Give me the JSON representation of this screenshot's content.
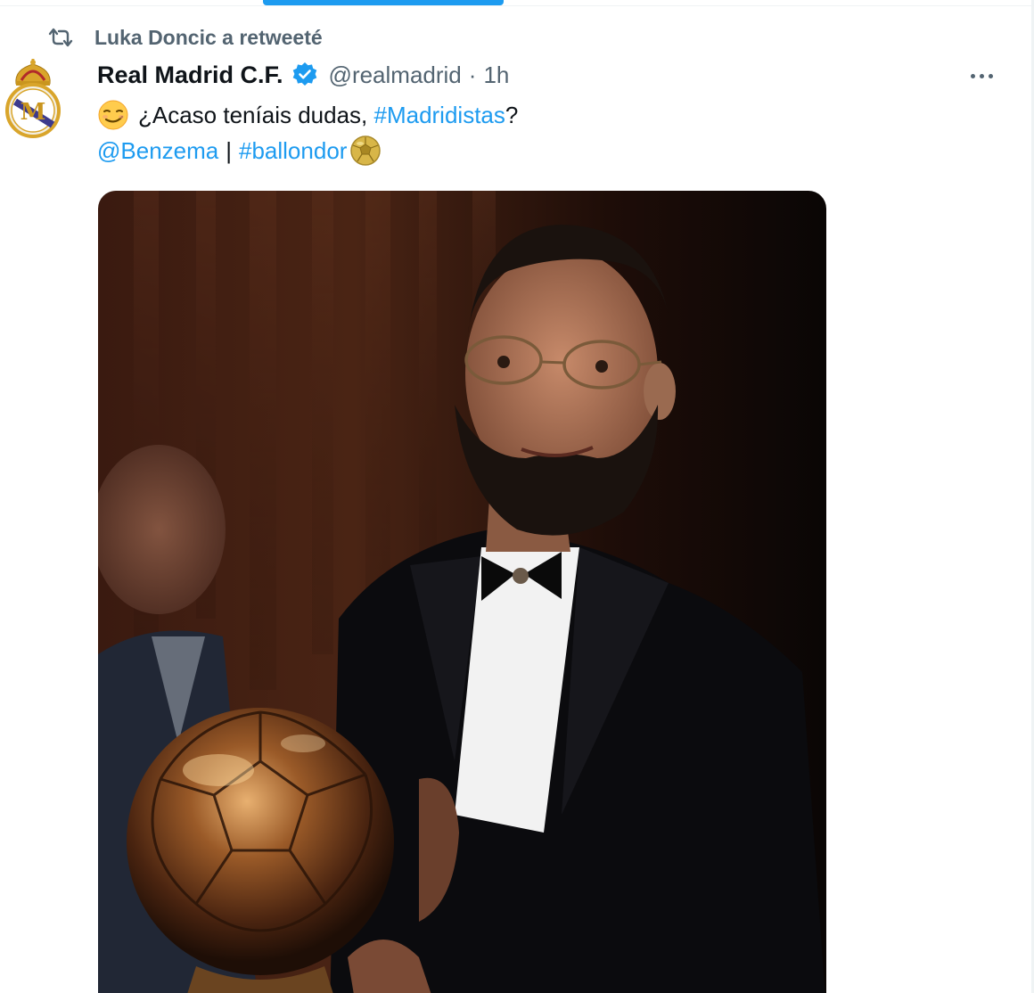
{
  "retweet_context": {
    "icon": "retweet-icon",
    "text": "Luka Doncic a retweeté"
  },
  "tweet": {
    "author": {
      "display_name": "Real Madrid C.F.",
      "handle": "@realmadrid",
      "verified": true,
      "avatar": "real-madrid-crest"
    },
    "separator": "·",
    "time": "1h",
    "more_icon": "more-icon",
    "text": {
      "line1_emoji": "smirk-emoji",
      "line1_text": "¿Acaso teníais dudas, ",
      "line1_hashtag": "#Madridistas",
      "line1_end": "?",
      "line2_mention": "@Benzema",
      "line2_separator": "|",
      "line2_hashtag": "#ballondor",
      "line2_emoji": "ballon-dor-emoji"
    },
    "media": {
      "type": "photo",
      "subject": "man in tuxedo holding golden ball trophy"
    }
  },
  "colors": {
    "link": "#1d9bf0",
    "text_primary": "#0f1419",
    "text_secondary": "#536471",
    "accent_tab": "#1d9bf0"
  }
}
